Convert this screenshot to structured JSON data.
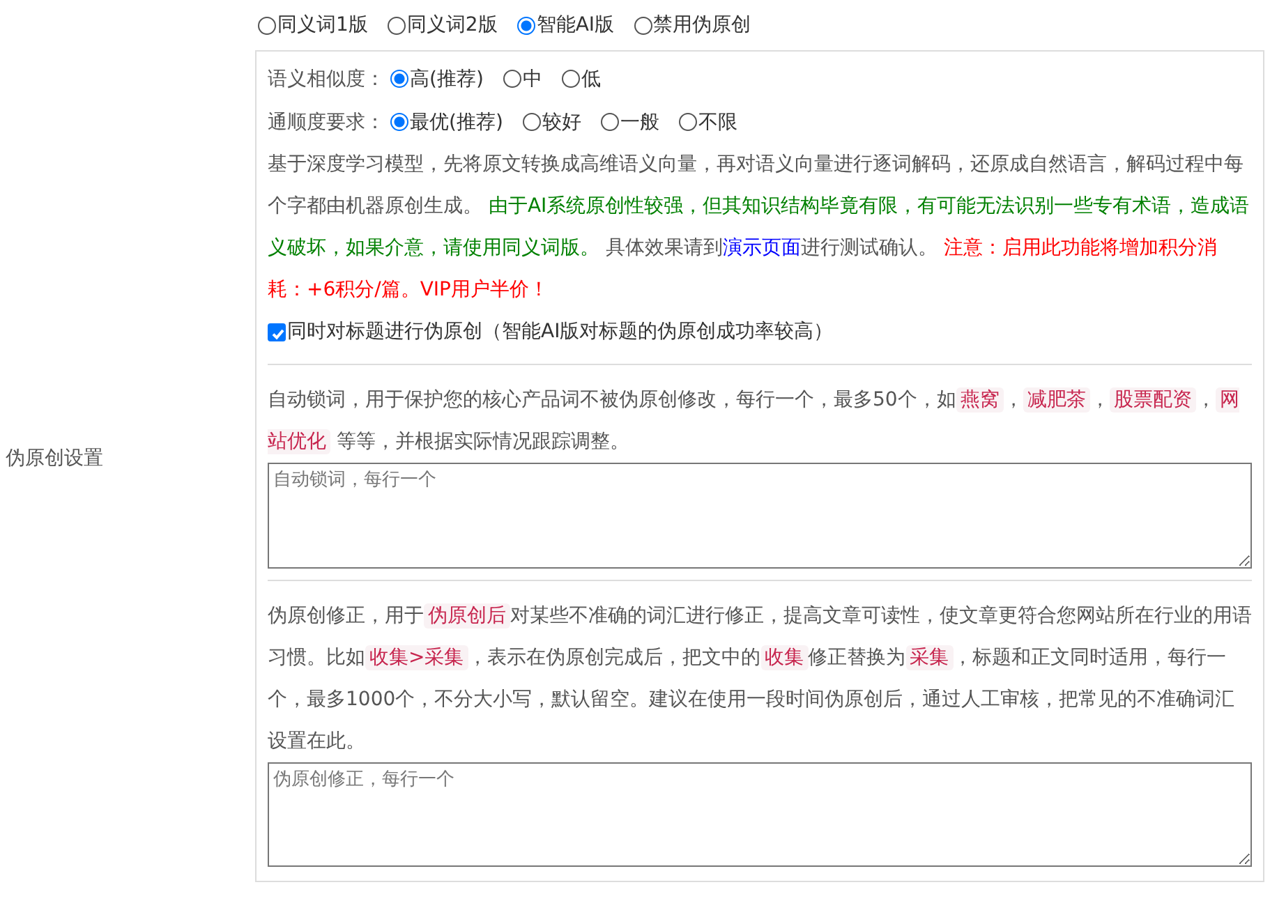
{
  "section_label": "伪原创设置",
  "modes": [
    {
      "label": "同义词1版",
      "selected": false
    },
    {
      "label": "同义词2版",
      "selected": false
    },
    {
      "label": "智能AI版",
      "selected": true
    },
    {
      "label": "禁用伪原创",
      "selected": false
    }
  ],
  "ai_options": [
    {
      "label": "语义相似度：",
      "options": [
        {
          "label": "高(推荐)",
          "selected": true
        },
        {
          "label": "中",
          "selected": false
        },
        {
          "label": "低",
          "selected": false
        }
      ]
    },
    {
      "label": "通顺度要求：",
      "options": [
        {
          "label": "最优(推荐)",
          "selected": true
        },
        {
          "label": "较好",
          "selected": false
        },
        {
          "label": "一般",
          "selected": false
        },
        {
          "label": "不限",
          "selected": false
        }
      ]
    }
  ],
  "ai_description": [
    {
      "kind": "text",
      "text": "基于深度学习模型，先将原文转换成高维语义向量，再对语义向量进行逐词解码，还原成自然语言，解码过程中每个字都由机器原创生成。 "
    },
    {
      "kind": "green",
      "text": "由于AI系统原创性较强，但其知识结构毕竟有限，有可能无法识别一些专有术语，造成语义破坏，如果介意，请使用同义词版。"
    },
    {
      "kind": "text",
      "text": " 具体效果请到"
    },
    {
      "kind": "link",
      "text": "演示页面"
    },
    {
      "kind": "text",
      "text": "进行测试确认。 "
    },
    {
      "kind": "red",
      "text": "注意：启用此功能将增加积分消耗：+6积分/篇。VIP用户半价！"
    }
  ],
  "title_option": {
    "label": "同时对标题进行伪原创（智能AI版对标题的伪原创成功率较高）",
    "checked": true
  },
  "lock_words": {
    "description": [
      {
        "kind": "text",
        "text": "自动锁词，用于保护您的核心产品词不被伪原创修改，每行一个，最多50个，如"
      },
      {
        "kind": "code",
        "text": "燕窝"
      },
      {
        "kind": "text",
        "text": "，"
      },
      {
        "kind": "code",
        "text": "减肥茶"
      },
      {
        "kind": "text",
        "text": "，"
      },
      {
        "kind": "code",
        "text": "股票配资"
      },
      {
        "kind": "text",
        "text": "，"
      },
      {
        "kind": "code",
        "text": "网站优化"
      },
      {
        "kind": "text",
        "text": " 等等，并根据实际情况跟踪调整。"
      }
    ],
    "placeholder": "自动锁词，每行一个"
  },
  "corrections": {
    "description": [
      {
        "kind": "text",
        "text": "伪原创修正，用于"
      },
      {
        "kind": "code",
        "text": "伪原创后"
      },
      {
        "kind": "text",
        "text": "对某些不准确的词汇进行修正，提高文章可读性，使文章更符合您网站所在行业的用语习惯。比如"
      },
      {
        "kind": "code",
        "text": "收集>采集"
      },
      {
        "kind": "text",
        "text": "，表示在伪原创完成后，把文中的"
      },
      {
        "kind": "code",
        "text": "收集"
      },
      {
        "kind": "text",
        "text": "修正替换为"
      },
      {
        "kind": "code",
        "text": "采集"
      },
      {
        "kind": "text",
        "text": "，标题和正文同时适用，每行一个，最多1000个，不分大小写，默认留空。建议在使用一段时间伪原创后，通过人工审核，把常见的不准确词汇设置在此。"
      }
    ],
    "placeholder": "伪原创修正，每行一个"
  }
}
